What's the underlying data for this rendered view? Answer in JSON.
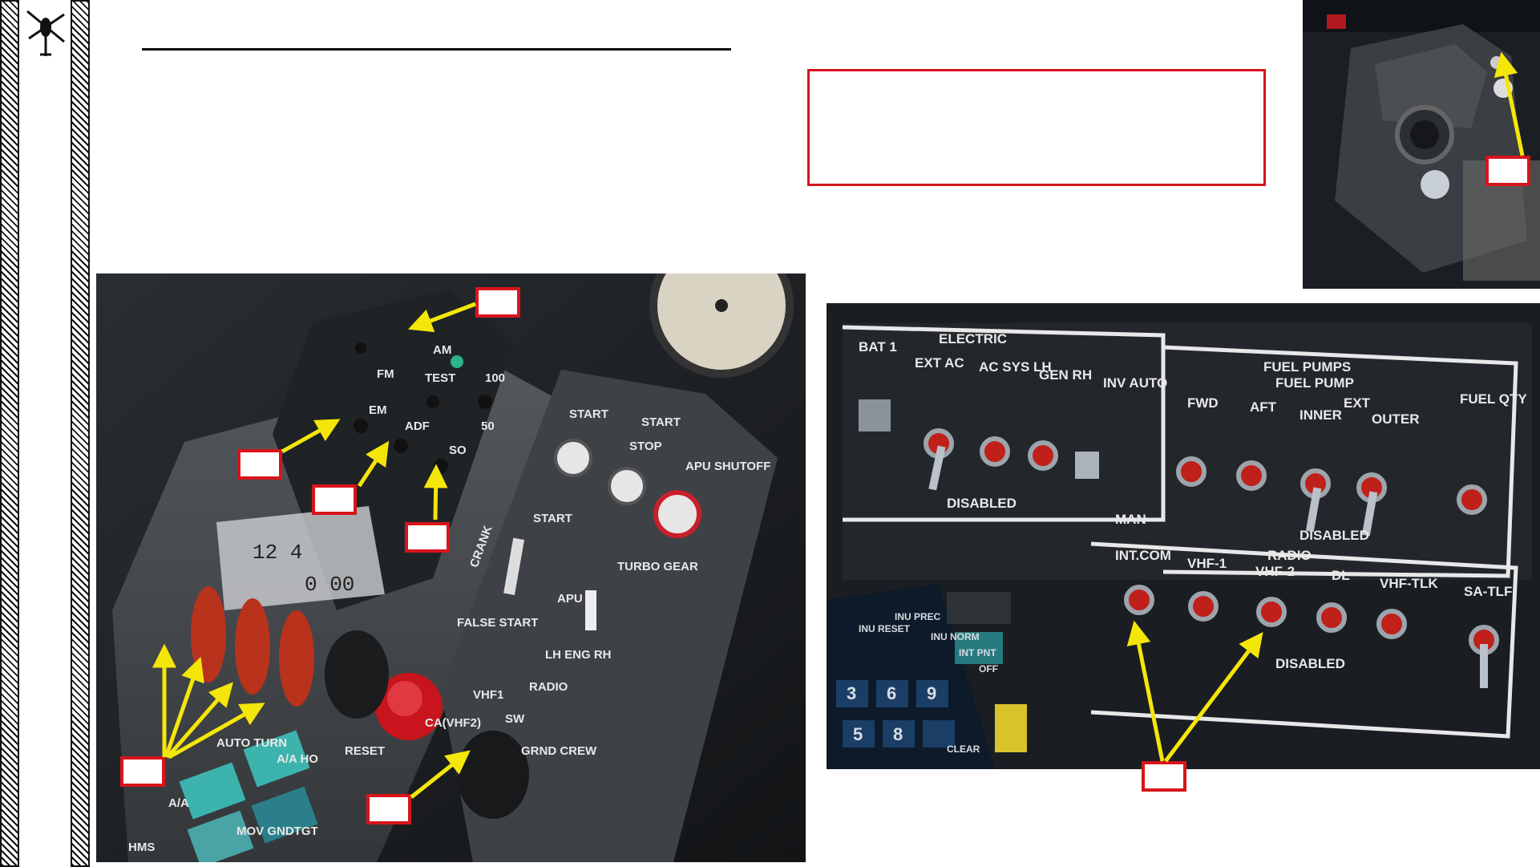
{
  "cockpit_labels": {
    "radio_panel": [
      "AM",
      "FM",
      "TEST",
      "100",
      "EM",
      "ADF",
      "50",
      "SO"
    ],
    "clock": [
      "12 4",
      "0 00"
    ],
    "engine_panel": [
      "START",
      "START",
      "STOP",
      "APU SHUTOFF",
      "START",
      "CRANK",
      "FALSE START",
      "TURBO GEAR",
      "APU",
      "LH ENG RH",
      "RADIO",
      "RESET",
      "VHF1",
      "SW",
      "GRND CREW",
      "CA(VHF2)",
      "A/A HO",
      "AUTO TURN",
      "A/A",
      "MOV GNDTGT",
      "HMS"
    ],
    "electric_panel": [
      "ELECTRIC",
      "BAT 1",
      "EXT AC",
      "AC SYS LH",
      "GEN RH",
      "INV AUTO",
      "DISABLED",
      "MAN"
    ],
    "fuel_panel": [
      "FUEL PUMPS",
      "FUEL PUMP",
      "FWD",
      "AFT",
      "EXT",
      "INNER",
      "OUTER",
      "FUEL QTY",
      "DISABLED"
    ],
    "radio_switches": [
      "RADIO",
      "INT.COM",
      "VHF-1",
      "VHF-2",
      "DL",
      "VHF-TLK",
      "SA-TLF",
      "DISABLED"
    ],
    "keypad": [
      "INU RESET",
      "INU PREC",
      "INU NORM",
      "INT PNT",
      "CLEAR",
      "3",
      "6",
      "9",
      "5",
      "8",
      "OFF"
    ]
  },
  "colors": {
    "callout_red": "#d4141c",
    "arrow_yellow": "#f5e60a",
    "panel_dark": "#1e2226",
    "switch_red": "#c0201a"
  }
}
